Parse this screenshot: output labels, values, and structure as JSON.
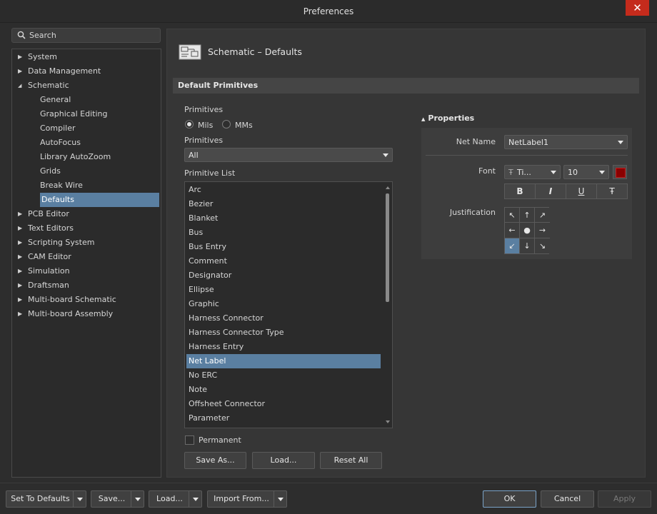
{
  "window": {
    "title": "Preferences",
    "close_label": "✕"
  },
  "search": {
    "placeholder": "Search"
  },
  "tree": [
    {
      "label": "System",
      "level": 0,
      "arrow": "▶"
    },
    {
      "label": "Data Management",
      "level": 0,
      "arrow": "▶"
    },
    {
      "label": "Schematic",
      "level": 0,
      "arrow": "◢"
    },
    {
      "label": "General",
      "level": 1
    },
    {
      "label": "Graphical Editing",
      "level": 1
    },
    {
      "label": "Compiler",
      "level": 1
    },
    {
      "label": "AutoFocus",
      "level": 1
    },
    {
      "label": "Library AutoZoom",
      "level": 1
    },
    {
      "label": "Grids",
      "level": 1
    },
    {
      "label": "Break Wire",
      "level": 1
    },
    {
      "label": "Defaults",
      "level": 1,
      "selected": true
    },
    {
      "label": "PCB Editor",
      "level": 0,
      "arrow": "▶"
    },
    {
      "label": "Text Editors",
      "level": 0,
      "arrow": "▶"
    },
    {
      "label": "Scripting System",
      "level": 0,
      "arrow": "▶"
    },
    {
      "label": "CAM Editor",
      "level": 0,
      "arrow": "▶"
    },
    {
      "label": "Simulation",
      "level": 0,
      "arrow": "▶"
    },
    {
      "label": "Draftsman",
      "level": 0,
      "arrow": "▶"
    },
    {
      "label": "Multi-board Schematic",
      "level": 0,
      "arrow": "▶"
    },
    {
      "label": "Multi-board Assembly",
      "level": 0,
      "arrow": "▶"
    }
  ],
  "page": {
    "title": "Schematic – Defaults",
    "section": "Default Primitives"
  },
  "primitives": {
    "units_label": "Primitives",
    "unit_mils": "Mils",
    "unit_mms": "MMs",
    "filter_label": "Primitives",
    "filter_value": "All",
    "list_label": "Primitive List",
    "list": [
      "Arc",
      "Bezier",
      "Blanket",
      "Bus",
      "Bus Entry",
      "Comment",
      "Designator",
      "Ellipse",
      "Graphic",
      "Harness Connector",
      "Harness Connector Type",
      "Harness Entry",
      "Net Label",
      "No ERC",
      "Note",
      "Offsheet Connector",
      "Parameter"
    ],
    "selected": "Net Label",
    "permanent_label": "Permanent",
    "save_as": "Save As...",
    "load": "Load...",
    "reset_all": "Reset All"
  },
  "properties": {
    "header": "Properties",
    "net_name_label": "Net Name",
    "net_name_value": "NetLabel1",
    "font_label": "Font",
    "font_value": "Ti...",
    "font_size": "10",
    "font_color": "#8b0000",
    "bold": "B",
    "italic": "I",
    "underline": "U",
    "strike": "Ŧ",
    "justification_label": "Justification",
    "justification": [
      "↖",
      "↑",
      "↗",
      "←",
      "●",
      "→",
      "↙",
      "↓",
      "↘"
    ],
    "justification_selected": 6
  },
  "footer": {
    "set_defaults": "Set To Defaults",
    "save": "Save...",
    "load": "Load...",
    "import_from": "Import From...",
    "ok": "OK",
    "cancel": "Cancel",
    "apply": "Apply"
  }
}
